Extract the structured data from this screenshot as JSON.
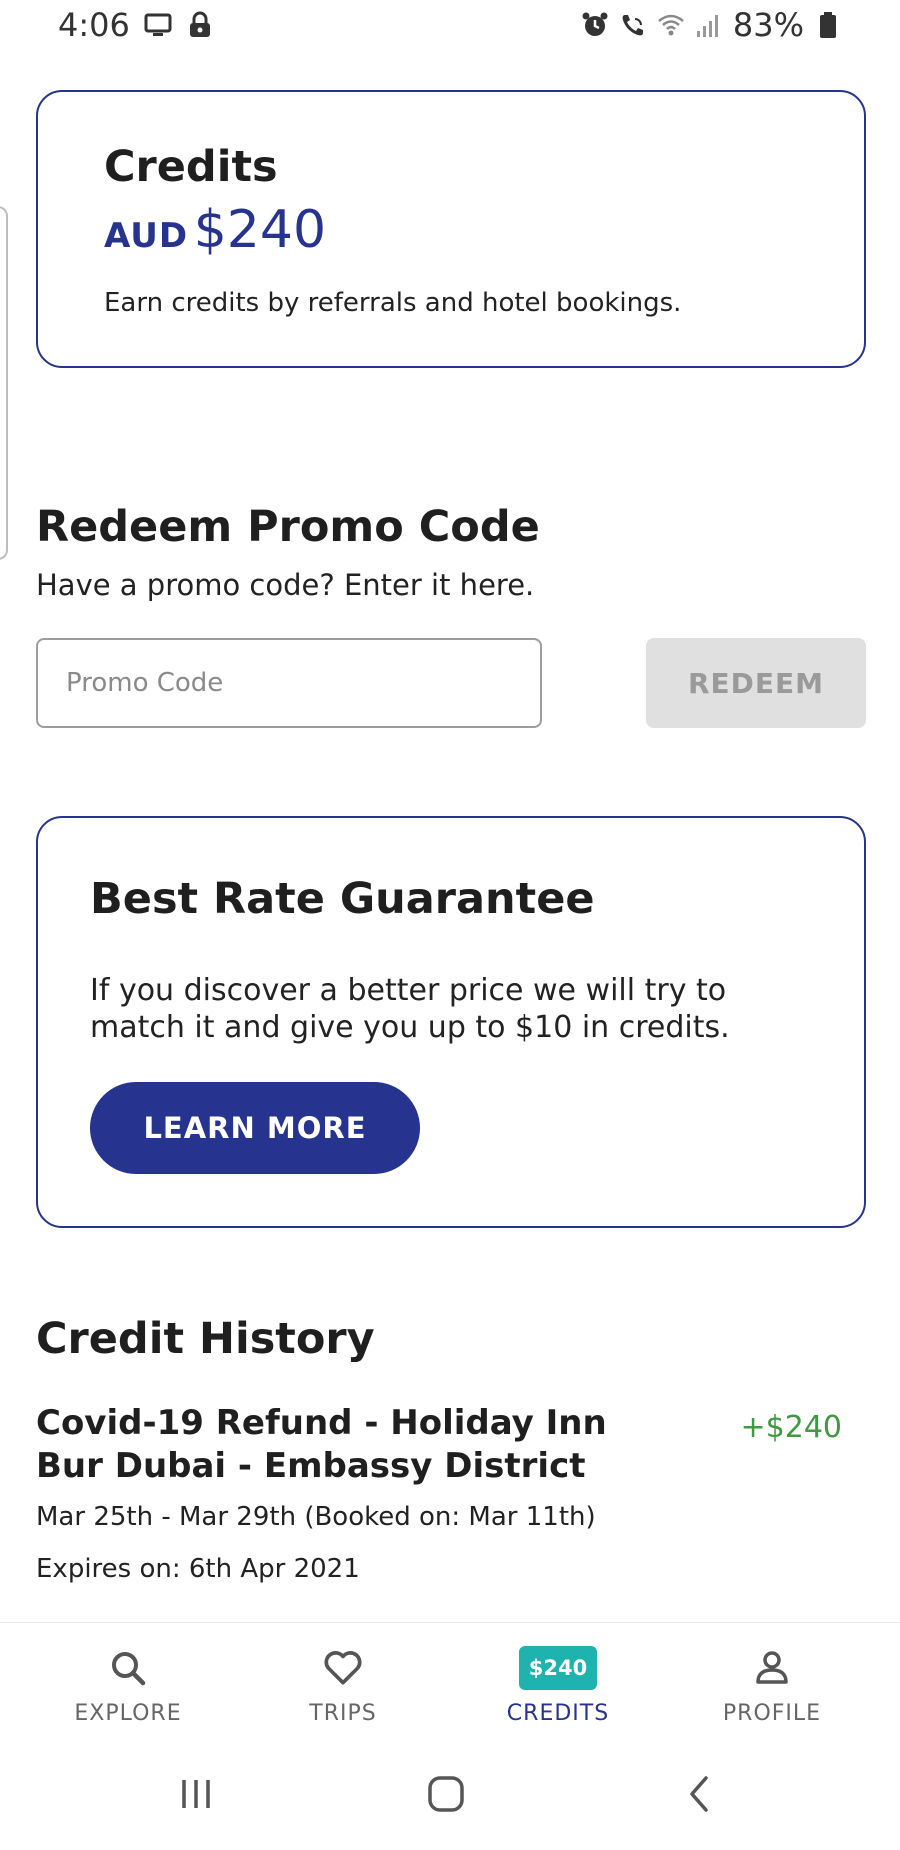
{
  "status_bar": {
    "time": "4:06",
    "battery": "83%"
  },
  "credits_card": {
    "title": "Credits",
    "currency": "AUD",
    "amount": "$240",
    "subtitle": "Earn credits by referrals and hotel bookings."
  },
  "promo": {
    "title": "Redeem Promo Code",
    "subtitle": "Have a promo code? Enter it here.",
    "input_placeholder": "Promo Code",
    "input_value": "",
    "redeem_label": "REDEEM"
  },
  "best_rate": {
    "title": "Best Rate Guarantee",
    "text": "If you discover a better price we will try to match it and give you up to $10 in credits.",
    "button_label": "LEARN MORE"
  },
  "credit_history": {
    "title": "Credit History",
    "items": [
      {
        "name": "Covid-19 Refund - Holiday Inn Bur Dubai - Embassy District",
        "amount": "+$240",
        "dates": "Mar 25th - Mar 29th (Booked on: Mar 11th)",
        "expiry": "Expires on: 6th Apr 2021"
      }
    ]
  },
  "bottom_nav": {
    "items": [
      {
        "label": "EXPLORE",
        "icon": "search-icon"
      },
      {
        "label": "TRIPS",
        "icon": "heart-icon"
      },
      {
        "label": "CREDITS",
        "icon": "credit-badge",
        "badge": "$240",
        "active": true
      },
      {
        "label": "PROFILE",
        "icon": "person-icon"
      }
    ]
  },
  "colors": {
    "primary": "#26338f",
    "positive": "#3e9a3e",
    "badge": "#1fb3b0",
    "disabled_button": "#e0e0e0"
  }
}
